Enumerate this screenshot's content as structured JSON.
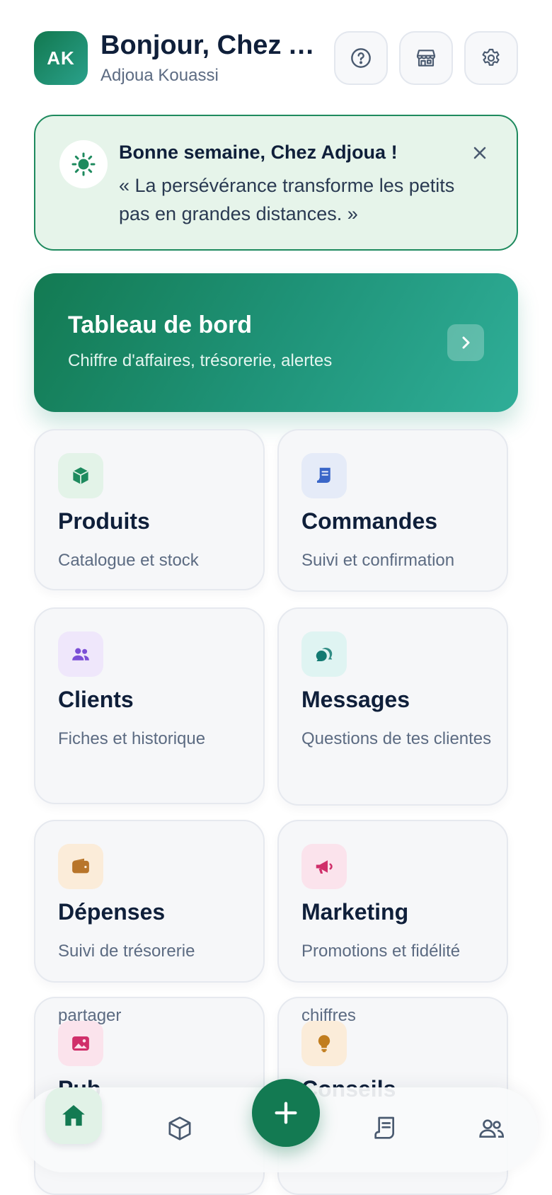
{
  "header": {
    "avatar_initials": "AK",
    "greeting": "Bonjour, Chez Adjoua",
    "user_name": "Adjoua Kouassi",
    "buttons": [
      "help-icon",
      "store-icon",
      "settings-icon"
    ]
  },
  "quote_card": {
    "title": "Bonne semaine, Chez Adjoua !",
    "text": "« La persévérance transforme les petits pas en grandes distances. »",
    "icon": "sun-icon"
  },
  "dashboard": {
    "title": "Tableau de bord",
    "subtitle": "Chiffre d'affaires, trésorerie, alertes"
  },
  "tiles": [
    {
      "name": "Produits",
      "desc": "Catalogue et stock",
      "icon": "box-icon",
      "color": "#1e8a5e",
      "bg": "#e3f3e8"
    },
    {
      "name": "Commandes",
      "desc": "Suivi et confirmation",
      "icon": "receipt-icon",
      "color": "#3a66c8",
      "bg": "#e5ebf8"
    },
    {
      "name": "Clients",
      "desc": "Fiches et historique",
      "icon": "users-icon",
      "color": "#7b4fd6",
      "bg": "#efe7fb"
    },
    {
      "name": "Messages",
      "desc": "Questions de tes clientes",
      "icon": "chat-icon",
      "color": "#137a72",
      "bg": "#dff4f2"
    },
    {
      "name": "Dépenses",
      "desc": "Suivi de trésorerie",
      "icon": "wallet-icon",
      "color": "#b8752a",
      "bg": "#fbecd9"
    },
    {
      "name": "Marketing",
      "desc": "Promotions et fidélité",
      "icon": "megaphone-icon",
      "color": "#d02f6a",
      "bg": "#fbe3ec"
    },
    {
      "name": "Pub",
      "desc": "partager",
      "icon": "image-icon",
      "color": "#d02f6a",
      "bg": "#fbe3ec"
    },
    {
      "name": "Conseils",
      "desc": "chiffres",
      "icon": "bulb-icon",
      "color": "#c17d1e",
      "bg": "#fbecd9"
    }
  ],
  "bottom_nav": {
    "items": [
      "home-icon",
      "box-icon",
      "add-icon",
      "receipt-icon",
      "users-icon"
    ],
    "active": "home",
    "accent": "#137a52"
  }
}
